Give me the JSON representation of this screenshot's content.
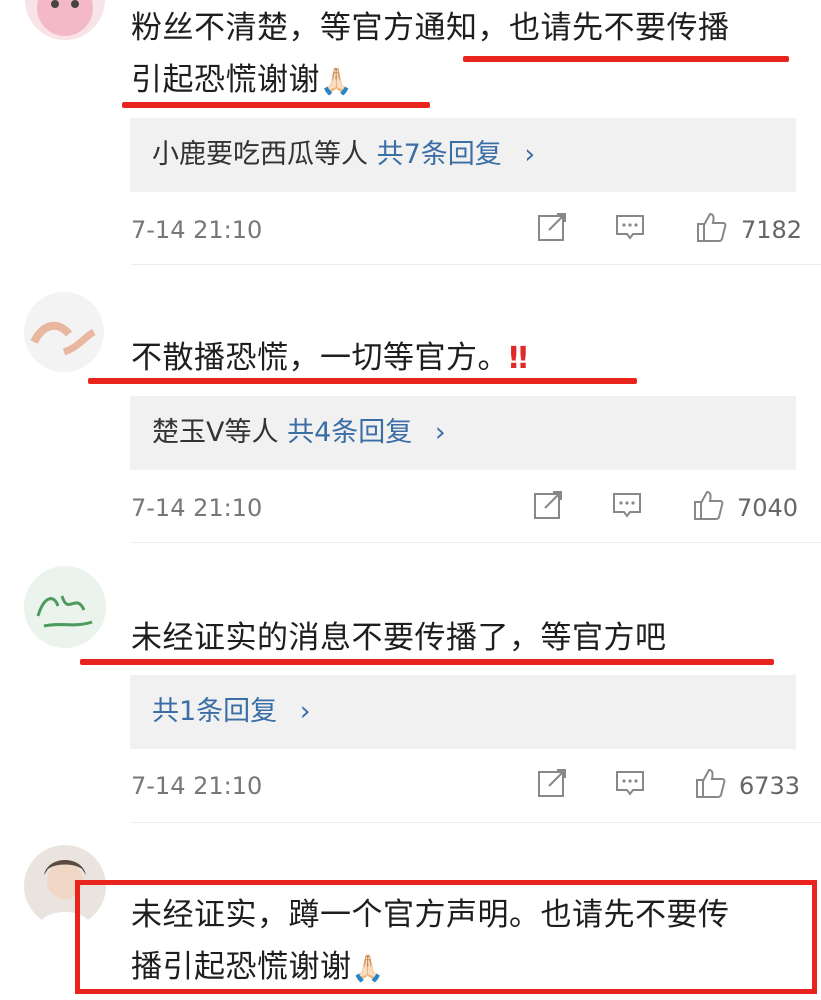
{
  "comments": [
    {
      "text_line1": "粉丝不清楚，等官方通知，也请先不要传播",
      "text_line2": "引起恐慌谢谢",
      "emoji": "🙏🏻",
      "replies_users": "小鹿要吃西瓜等人",
      "replies_count": "共7条回复",
      "time": "7-14 21:10",
      "likes": "7182"
    },
    {
      "text_line1": "不散播恐慌，一切等官方。",
      "emoji": "‼",
      "replies_users": "楚玉V等人",
      "replies_count": "共4条回复",
      "time": "7-14 21:10",
      "likes": "7040"
    },
    {
      "text_line1": "未经证实的消息不要传播了，等官方吧",
      "replies_count": "共1条回复",
      "time": "7-14 21:10",
      "likes": "6733"
    },
    {
      "text_line1": "未经证实，蹲一个官方声明。也请先不要传",
      "text_line2": "播引起恐慌谢谢",
      "emoji": "🙏🏻"
    }
  ],
  "icons": {
    "share": "share-icon",
    "comment": "comment-icon",
    "like": "thumbs-up-icon",
    "chevron": "chevron-right-icon"
  },
  "colors": {
    "highlight_red": "#e8241c",
    "link_blue": "#3c6ea6",
    "reply_bg": "#f1f1f1"
  }
}
